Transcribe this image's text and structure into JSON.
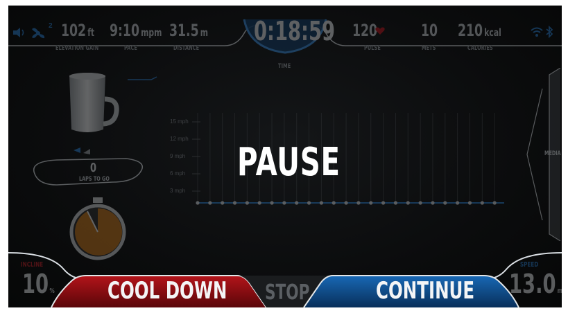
{
  "top_bar": {
    "stats_left": [
      {
        "id": "elevation",
        "value": "102",
        "unit": "ft",
        "label": "ELEVATION GAIN"
      },
      {
        "id": "pace",
        "value": "9:10",
        "unit": "mpm",
        "label": "PACE"
      },
      {
        "id": "distance",
        "value": "31.5",
        "unit": "m",
        "label": "DISTANCE"
      }
    ],
    "time": {
      "value": "0:18:59",
      "label": "TIME"
    },
    "stats_right": [
      {
        "id": "pulse",
        "value": "120",
        "unit": "",
        "label": "PULSE"
      },
      {
        "id": "mets",
        "value": "10",
        "unit": "",
        "label": "METS"
      },
      {
        "id": "calories",
        "value": "210",
        "unit": "kcal",
        "label": "CALORIES"
      }
    ],
    "fan_level": "2",
    "icons": {
      "sound": "speaker-icon",
      "fan": "fan-icon",
      "heart": "heart-icon",
      "wifi": "wifi-icon",
      "bluetooth": "bluetooth-icon"
    }
  },
  "track": {
    "laps_value": "0",
    "laps_label": "LAPS TO GO"
  },
  "chart": {
    "y_ticks": [
      "15 mph",
      "12 mph",
      "9 mph",
      "6 mph",
      "3 mph"
    ],
    "point_count": 26,
    "series_value": 0
  },
  "overlay": {
    "pause_text": "PAUSE"
  },
  "media_tab": {
    "label": "MEDIA"
  },
  "incline": {
    "label": "INCLINE",
    "value": "10",
    "unit": "%"
  },
  "speed": {
    "label": "SPEED",
    "value": "13.0",
    "unit": "mph"
  },
  "buttons": {
    "cool_down": "COOL DOWN",
    "stop": "STOP",
    "continue": "CONTINUE"
  },
  "colors": {
    "cool_down": "#8e0f14",
    "continue": "#0f4f8e",
    "accent_blue": "#2a7fd0",
    "heart": "#c0141c",
    "incline_label": "#7a1418",
    "speed_label": "#1d5a9c"
  }
}
